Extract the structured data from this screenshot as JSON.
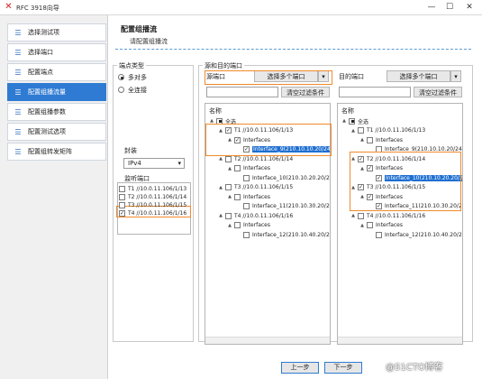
{
  "window": {
    "title": "RFC 3918向导",
    "minimize": "—",
    "maximize": "☐",
    "close": "✕"
  },
  "sidebar": {
    "items": [
      {
        "label": "选择测试项"
      },
      {
        "label": "选择端口"
      },
      {
        "label": "配置端点"
      },
      {
        "label": "配置组播流量"
      },
      {
        "label": "配置组播参数"
      },
      {
        "label": "配置测试选项"
      },
      {
        "label": "配置组转发矩阵"
      }
    ]
  },
  "header": {
    "title": "配置组播流",
    "subtitle": "请配置组播流"
  },
  "endpoint_type": {
    "legend": "端点类型",
    "options": [
      {
        "label": "多对多",
        "selected": true
      },
      {
        "label": "全连接",
        "selected": false
      }
    ]
  },
  "encapsulation": {
    "label": "封装",
    "value": "IPv4"
  },
  "listen_ports": {
    "legend": "监听端口",
    "items": [
      {
        "label": "T1 //10.0.11.106/1/13",
        "checked": false
      },
      {
        "label": "T2 //10.0.11.106/1/14",
        "checked": false
      },
      {
        "label": "T3 //10.0.11.106/1/15",
        "checked": false
      },
      {
        "label": "T4 //10.0.11.106/1/16",
        "checked": true
      }
    ]
  },
  "ports_group": {
    "legend": "源和目的端口"
  },
  "source": {
    "title": "源端口",
    "select_btn": "选择多个端口",
    "clear_btn": "清空过滤条件",
    "column": "名称",
    "tree": [
      {
        "label": "全选",
        "level": 0,
        "state": "part",
        "expand": "▲"
      },
      {
        "label": "T1 //10.0.11.106/1/13",
        "level": 1,
        "state": "checked",
        "expand": "▲"
      },
      {
        "label": "Interfaces",
        "level": 2,
        "state": "checked",
        "expand": "▲"
      },
      {
        "label": "Interface_9(210.10.10.20/24)",
        "level": 3,
        "state": "checked",
        "selected": true
      },
      {
        "label": "T2 //10.0.11.106/1/14",
        "level": 1,
        "state": "none",
        "expand": "▲"
      },
      {
        "label": "Interfaces",
        "level": 2,
        "state": "none",
        "expand": "▲"
      },
      {
        "label": "Interface_10(210.10.20.20/24)",
        "level": 3,
        "state": "none"
      },
      {
        "label": "T3 //10.0.11.106/1/15",
        "level": 1,
        "state": "none",
        "expand": "▲"
      },
      {
        "label": "Interfaces",
        "level": 2,
        "state": "none",
        "expand": "▲"
      },
      {
        "label": "Interface_11(210.10.30.20/24)",
        "level": 3,
        "state": "none"
      },
      {
        "label": "T4 //10.0.11.106/1/16",
        "level": 1,
        "state": "none",
        "expand": "▲"
      },
      {
        "label": "Interfaces",
        "level": 2,
        "state": "none",
        "expand": "▲"
      },
      {
        "label": "Interface_12(210.10.40.20/24)",
        "level": 3,
        "state": "none"
      }
    ]
  },
  "dest": {
    "title": "目的端口",
    "select_btn": "选择多个端口",
    "clear_btn": "清空过滤条件",
    "column": "名称",
    "tree": [
      {
        "label": "全选",
        "level": 0,
        "state": "part",
        "expand": "▲"
      },
      {
        "label": "T1 //10.0.11.106/1/13",
        "level": 1,
        "state": "none",
        "expand": "▲"
      },
      {
        "label": "Interfaces",
        "level": 2,
        "state": "none",
        "expand": "▲"
      },
      {
        "label": "Interface_9(210.10.10.20/24)",
        "level": 3,
        "state": "none"
      },
      {
        "label": "T2 //10.0.11.106/1/14",
        "level": 1,
        "state": "checked",
        "expand": "▲"
      },
      {
        "label": "Interfaces",
        "level": 2,
        "state": "checked",
        "expand": "▲"
      },
      {
        "label": "Interface_10(210.10.20.20/24)",
        "level": 3,
        "state": "checked",
        "selected": true
      },
      {
        "label": "T3 //10.0.11.106/1/15",
        "level": 1,
        "state": "checked",
        "expand": "▲"
      },
      {
        "label": "Interfaces",
        "level": 2,
        "state": "checked",
        "expand": "▲"
      },
      {
        "label": "Interface_11(210.10.30.20/24)",
        "level": 3,
        "state": "checked"
      },
      {
        "label": "T4 //10.0.11.106/1/16",
        "level": 1,
        "state": "none",
        "expand": "▲"
      },
      {
        "label": "Interfaces",
        "level": 2,
        "state": "none",
        "expand": "▲"
      },
      {
        "label": "Interface_12(210.10.40.20/24)",
        "level": 3,
        "state": "none"
      }
    ]
  },
  "footer": {
    "prev": "上一步",
    "next": "下一步"
  },
  "watermark": "@51CTO博客",
  "colors": {
    "accent": "#2f7bd3",
    "highlight": "#f08a2c",
    "selection": "#1e6fd1"
  }
}
